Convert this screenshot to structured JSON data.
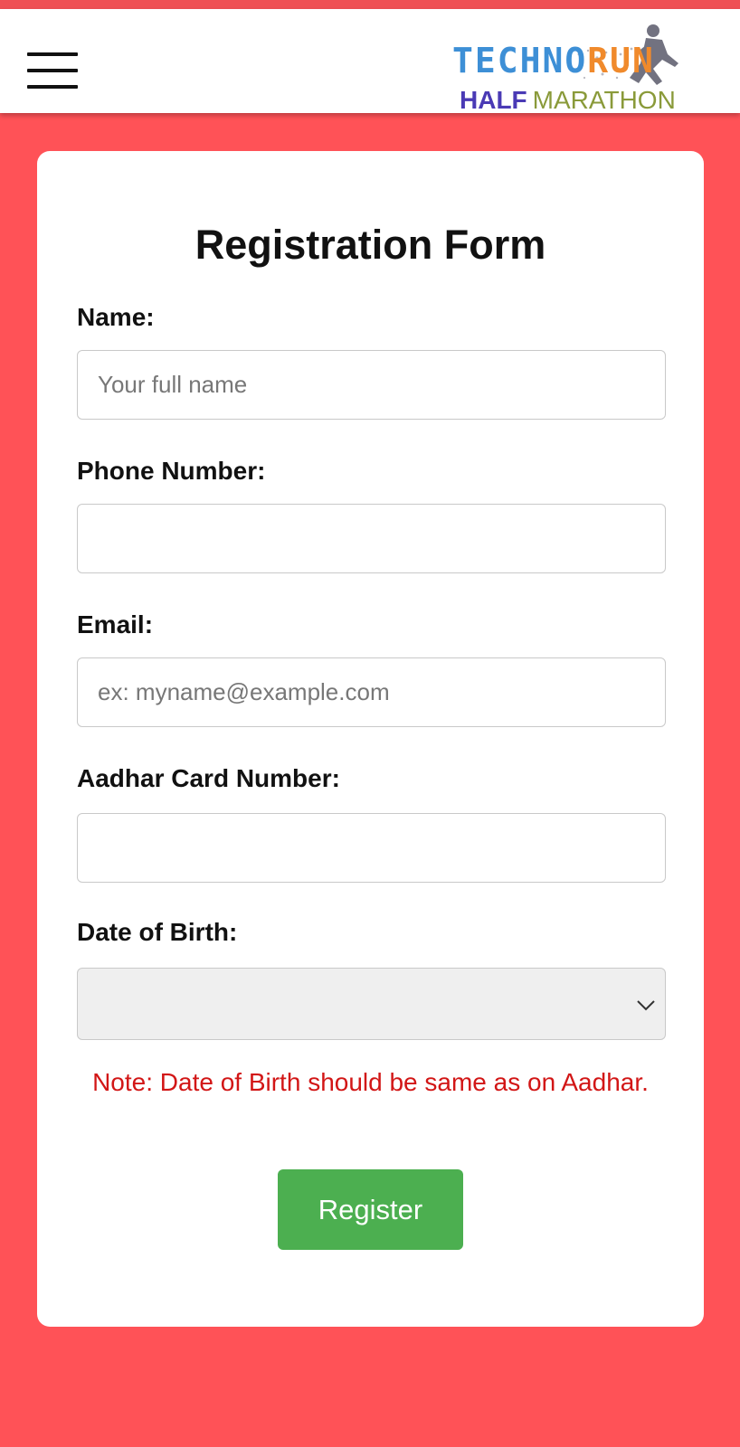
{
  "header": {
    "menu_icon": "hamburger-menu-icon",
    "logo": {
      "line1": "TECHNORUN",
      "line2_a": "HALF",
      "line2_b": "MARATHON",
      "colors": {
        "techno": "#3d8fd6",
        "run": "#f08a2c",
        "half": "#4a3ab5",
        "marathon": "#8a9a3a"
      }
    }
  },
  "form": {
    "title": "Registration Form",
    "name": {
      "label": "Name:",
      "placeholder": "Your full name",
      "value": ""
    },
    "phone": {
      "label": "Phone Number:",
      "placeholder": "",
      "value": ""
    },
    "email": {
      "label": "Email:",
      "placeholder": "ex: myname@example.com",
      "value": ""
    },
    "aadhar": {
      "label": "Aadhar Card Number:",
      "placeholder": "",
      "value": ""
    },
    "dob": {
      "label": "Date of Birth:",
      "selected": ""
    },
    "note": "Note: Date of Birth should be same as on Aadhar.",
    "submit_label": "Register"
  },
  "colors": {
    "page_background": "#ff5257",
    "note_color": "#d21616",
    "button_color": "#4caf50"
  }
}
